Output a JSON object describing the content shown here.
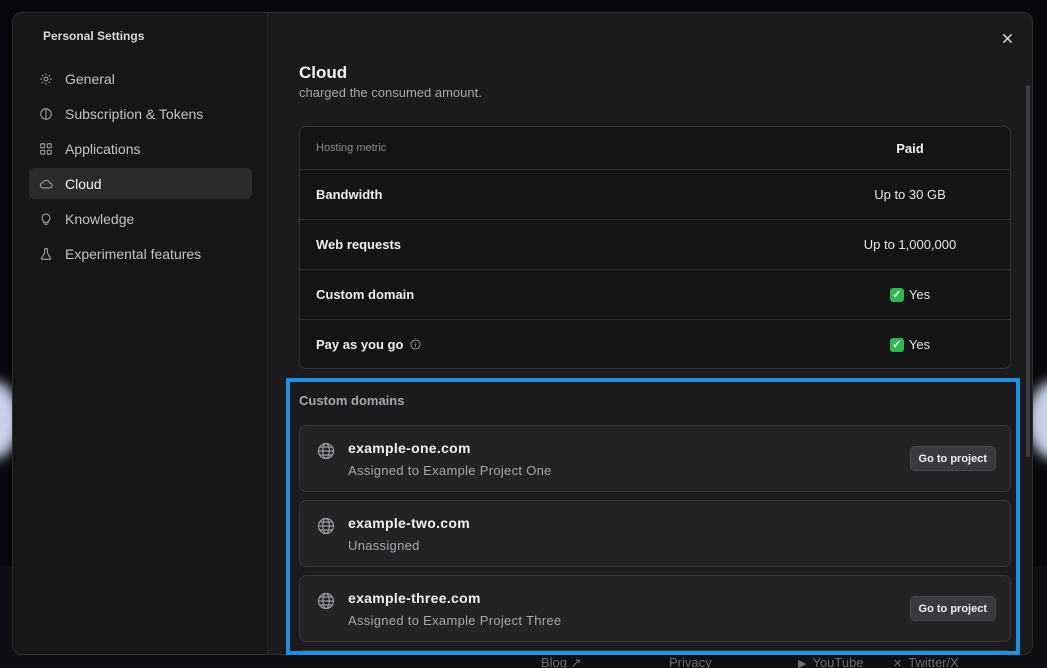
{
  "sidebar": {
    "title": "Personal Settings",
    "items": [
      {
        "label": "General",
        "icon": "gear-icon"
      },
      {
        "label": "Subscription & Tokens",
        "icon": "coin-icon"
      },
      {
        "label": "Applications",
        "icon": "apps-grid-icon"
      },
      {
        "label": "Cloud",
        "icon": "cloud-icon",
        "active": true
      },
      {
        "label": "Knowledge",
        "icon": "lightbulb-icon"
      },
      {
        "label": "Experimental features",
        "icon": "flask-icon"
      }
    ]
  },
  "main": {
    "title": "Cloud",
    "truncated_text": "charged the consumed amount."
  },
  "hosting_table": {
    "header": {
      "metric": "Hosting metric",
      "plan": "Paid"
    },
    "rows": [
      {
        "metric": "Bandwidth",
        "value": "Up to 30 GB"
      },
      {
        "metric": "Web requests",
        "value": "Up to 1,000,000"
      },
      {
        "metric": "Custom domain",
        "value": "Yes"
      },
      {
        "metric": "Pay as you go",
        "value": "Yes"
      }
    ]
  },
  "custom_domains": {
    "label": "Custom domains",
    "items": [
      {
        "domain": "example-one.com",
        "status": "Assigned to Example Project One",
        "button": "Go to project"
      },
      {
        "domain": "example-two.com",
        "status": "Unassigned"
      },
      {
        "domain": "example-three.com",
        "status": "Assigned to Example Project Three",
        "button": "Go to project"
      }
    ]
  },
  "footer": {
    "links": [
      "Blog",
      "Privacy",
      "YouTube",
      "Twitter/X"
    ]
  },
  "colors": {
    "highlight": "#1e90e0",
    "check": "#2fb84f"
  }
}
